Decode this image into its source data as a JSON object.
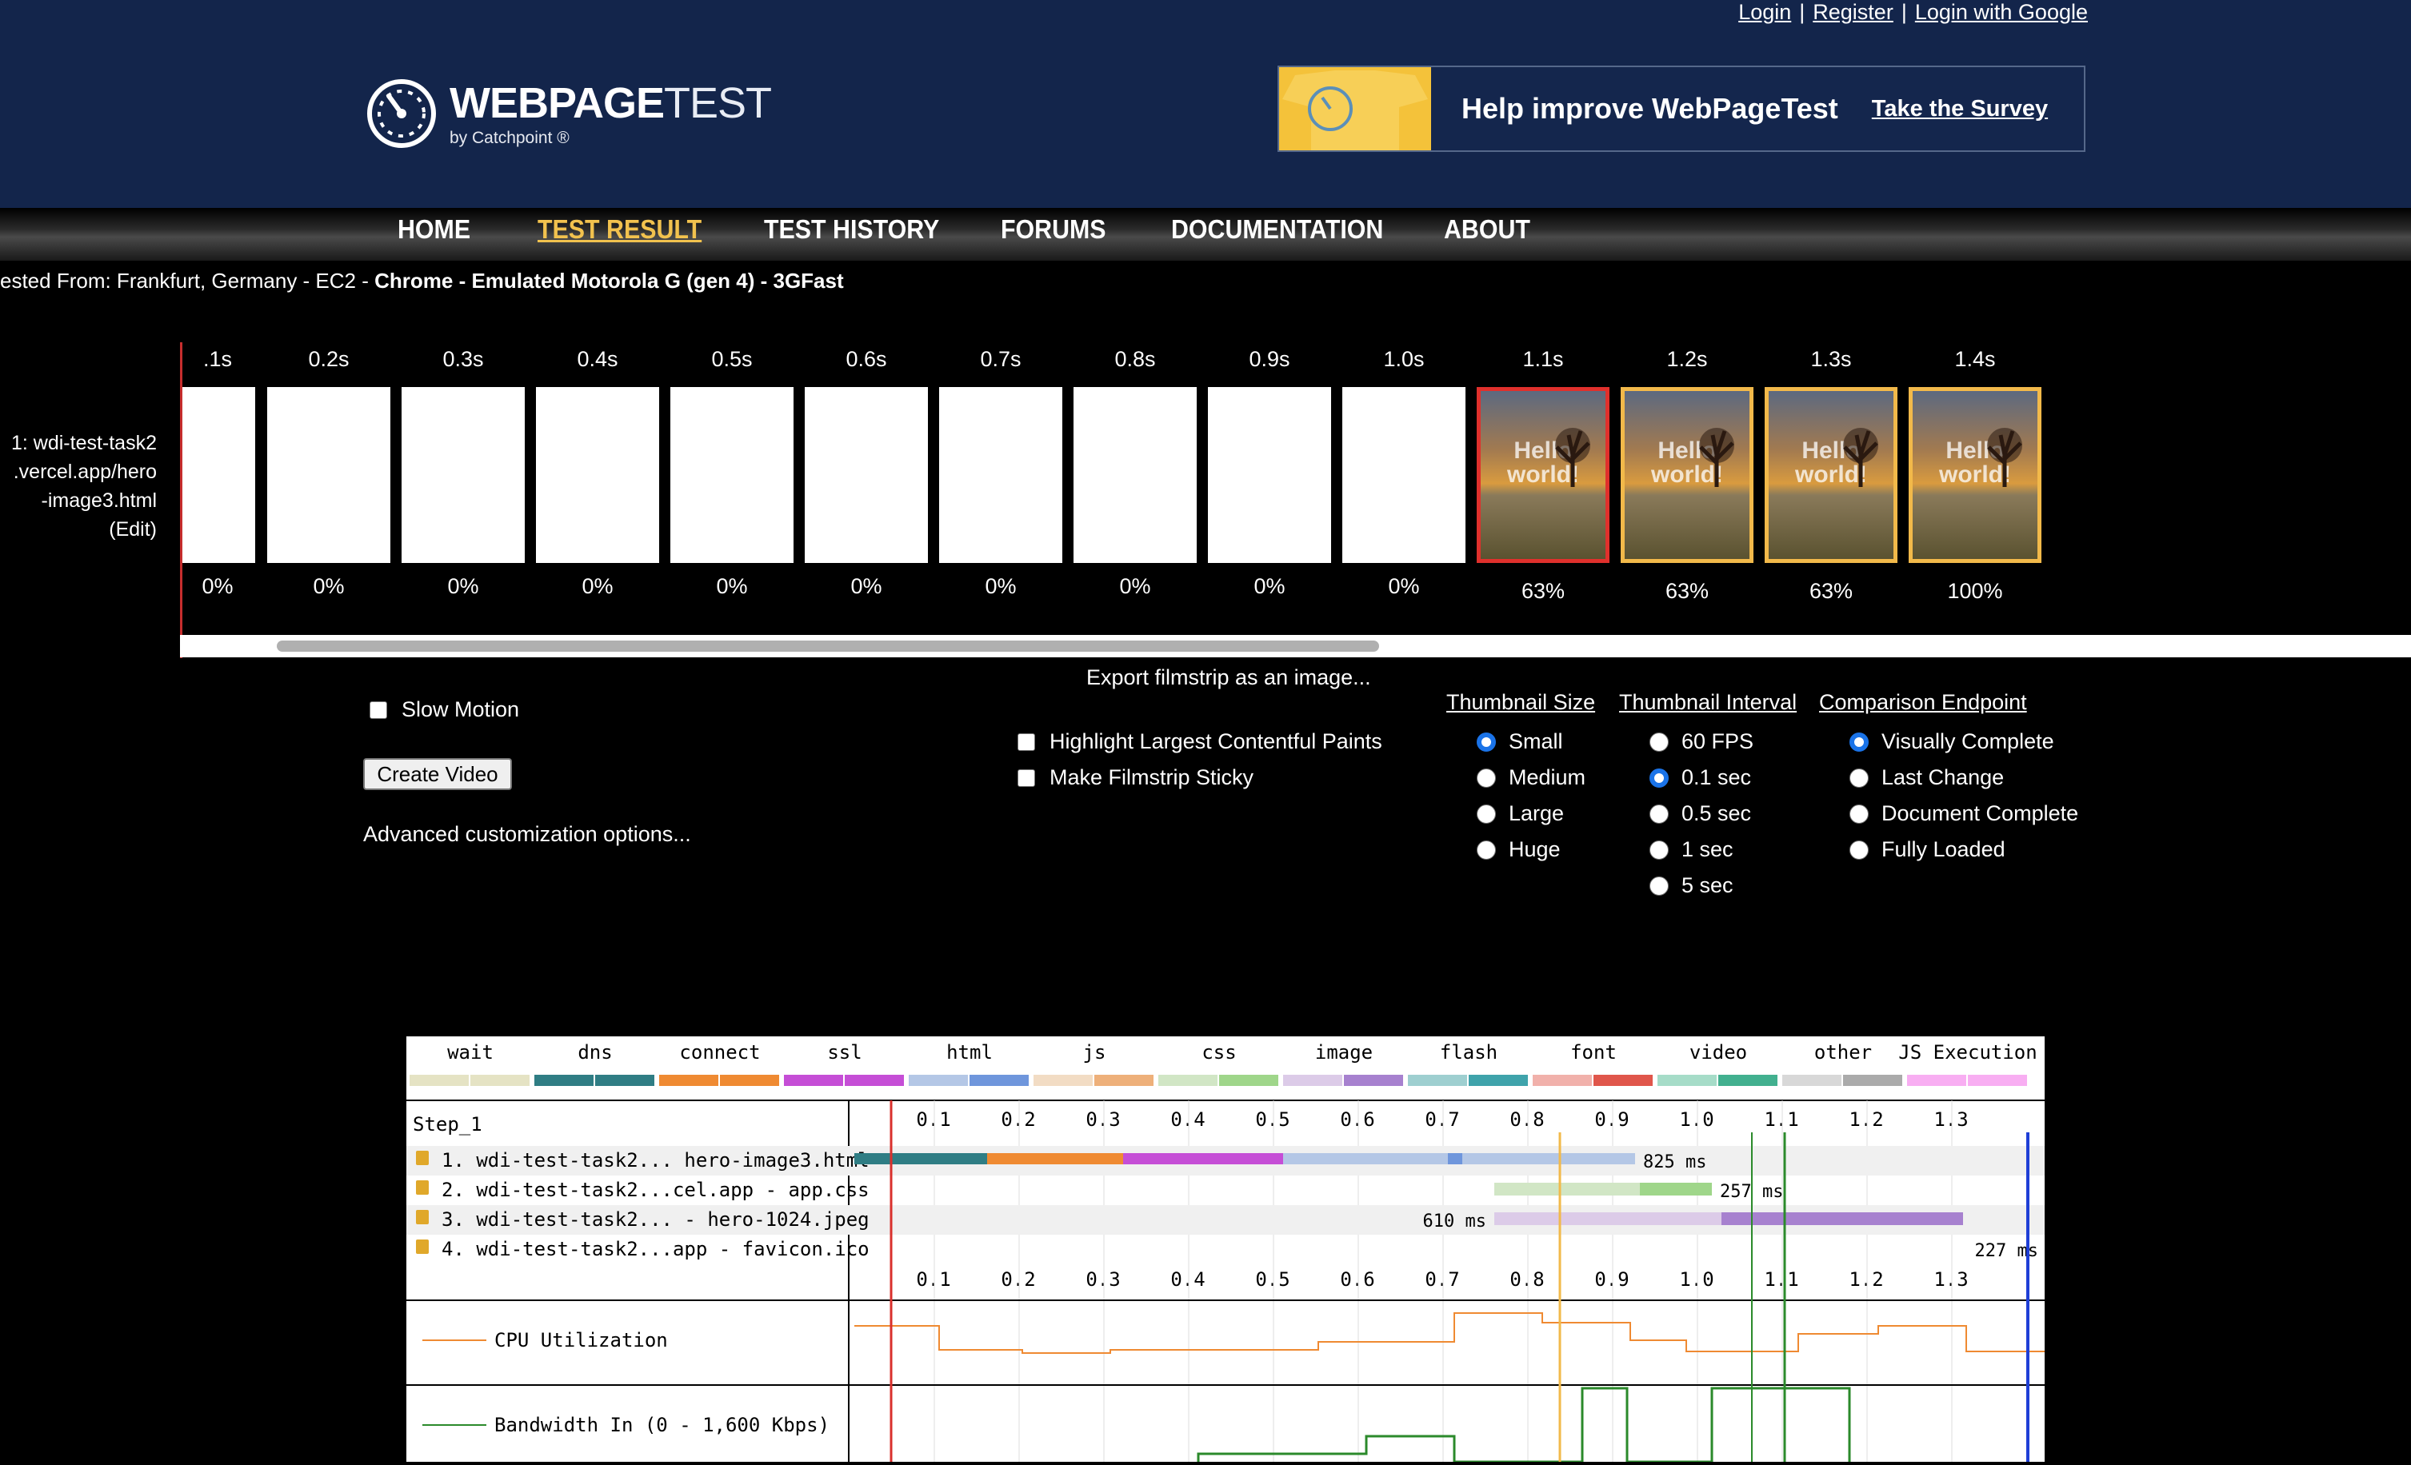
{
  "auth": {
    "login": "Login",
    "register": "Register",
    "google": "Login with Google",
    "sep": "|"
  },
  "logo": {
    "name_bold": "WEBPAGE",
    "name_light": "TEST",
    "byline": "by Catchpoint ®"
  },
  "banner": {
    "text": "Help improve WebPageTest",
    "link": "Take the Survey"
  },
  "nav": [
    "HOME",
    "TEST RESULT",
    "TEST HISTORY",
    "FORUMS",
    "DOCUMENTATION",
    "ABOUT"
  ],
  "nav_active": "TEST RESULT",
  "tested": {
    "prefix": "ested From: Frankfurt, Germany - EC2 - ",
    "bold": "Chrome - Emulated Motorola G (gen 4) - 3GFast"
  },
  "filmstrip": {
    "row_label": [
      "1: wdi-test-task2",
      ".vercel.app/hero",
      "-image3.html",
      "(Edit)"
    ],
    "frames": [
      {
        "time": ".1s",
        "pct": "0%",
        "img": false
      },
      {
        "time": "0.2s",
        "pct": "0%",
        "img": false
      },
      {
        "time": "0.3s",
        "pct": "0%",
        "img": false
      },
      {
        "time": "0.4s",
        "pct": "0%",
        "img": false
      },
      {
        "time": "0.5s",
        "pct": "0%",
        "img": false
      },
      {
        "time": "0.6s",
        "pct": "0%",
        "img": false
      },
      {
        "time": "0.7s",
        "pct": "0%",
        "img": false
      },
      {
        "time": "0.8s",
        "pct": "0%",
        "img": false
      },
      {
        "time": "0.9s",
        "pct": "0%",
        "img": false
      },
      {
        "time": "1.0s",
        "pct": "0%",
        "img": false
      },
      {
        "time": "1.1s",
        "pct": "63%",
        "img": true,
        "border": "red"
      },
      {
        "time": "1.2s",
        "pct": "63%",
        "img": true,
        "border": "orange"
      },
      {
        "time": "1.3s",
        "pct": "63%",
        "img": true,
        "border": "orange"
      },
      {
        "time": "1.4s",
        "pct": "100%",
        "img": true,
        "border": "orange"
      }
    ],
    "frame_text": "Hello world!"
  },
  "controls": {
    "slow_motion": "Slow Motion",
    "create_video": "Create Video",
    "advanced": "Advanced customization options...",
    "export": "Export filmstrip as an image...",
    "highlight_lcp": "Highlight Largest Contentful Paints",
    "sticky": "Make Filmstrip Sticky",
    "thumb_size": {
      "label": "Thumbnail Size",
      "options": [
        "Small",
        "Medium",
        "Large",
        "Huge"
      ],
      "selected": "Small"
    },
    "thumb_interval": {
      "label": "Thumbnail Interval",
      "options": [
        "60 FPS",
        "0.1 sec",
        "0.5 sec",
        "1 sec",
        "5 sec"
      ],
      "selected": "0.1 sec"
    },
    "endpoint": {
      "label": "Comparison Endpoint",
      "options": [
        "Visually Complete",
        "Last Change",
        "Document Complete",
        "Fully Loaded"
      ],
      "selected": "Visually Complete"
    }
  },
  "waterfall": {
    "legend": [
      {
        "label": "wait",
        "c1": "#e5e3c4",
        "c2": "#e5e3c4"
      },
      {
        "label": "dns",
        "c1": "#2f7d84",
        "c2": "#2f7d84"
      },
      {
        "label": "connect",
        "c1": "#ef8a32",
        "c2": "#ef8a32"
      },
      {
        "label": "ssl",
        "c1": "#c54ed6",
        "c2": "#c54ed6"
      },
      {
        "label": "html",
        "c1": "#b4c7e6",
        "c2": "#6f96dc"
      },
      {
        "label": "js",
        "c1": "#f2dcc4",
        "c2": "#eeb07a"
      },
      {
        "label": "css",
        "c1": "#d1e6c5",
        "c2": "#9fd68a"
      },
      {
        "label": "image",
        "c1": "#dccbe8",
        "c2": "#a781cf"
      },
      {
        "label": "flash",
        "c1": "#9ecfd0",
        "c2": "#3fa3ab"
      },
      {
        "label": "font",
        "c1": "#f1b1ab",
        "c2": "#e0564b"
      },
      {
        "label": "video",
        "c1": "#a6dcc8",
        "c2": "#42b08f"
      },
      {
        "label": "other",
        "c1": "#d8d8d8",
        "c2": "#ababab"
      },
      {
        "label": "JS Execution",
        "c1": "#f8aef2",
        "c2": "#f8aef2"
      }
    ],
    "step": "Step_1",
    "ticks": [
      "0.1",
      "0.2",
      "0.3",
      "0.4",
      "0.5",
      "0.6",
      "0.7",
      "0.8",
      "0.9",
      "1.0",
      "1.1",
      "1.2",
      "1.3"
    ],
    "requests": [
      {
        "label": "1. wdi-test-task2... hero-image3.html",
        "ms": "825 ms"
      },
      {
        "label": "2. wdi-test-task2...cel.app - app.css",
        "ms": "257 ms"
      },
      {
        "label": "3. wdi-test-task2... - hero-1024.jpeg",
        "ms": "610 ms"
      },
      {
        "label": "4. wdi-test-task2...app - favicon.ico",
        "ms": "227 ms"
      }
    ],
    "cpu_label": "CPU Utilization",
    "bw_label": "Bandwidth In (0 - 1,600 Kbps)",
    "colors": {
      "cpu": "#ef8a32",
      "bandwidth": "#2b8a2b",
      "start_render": "#d9302c",
      "lcp": "#f2b94a",
      "visual": "#1f3fd6"
    }
  }
}
